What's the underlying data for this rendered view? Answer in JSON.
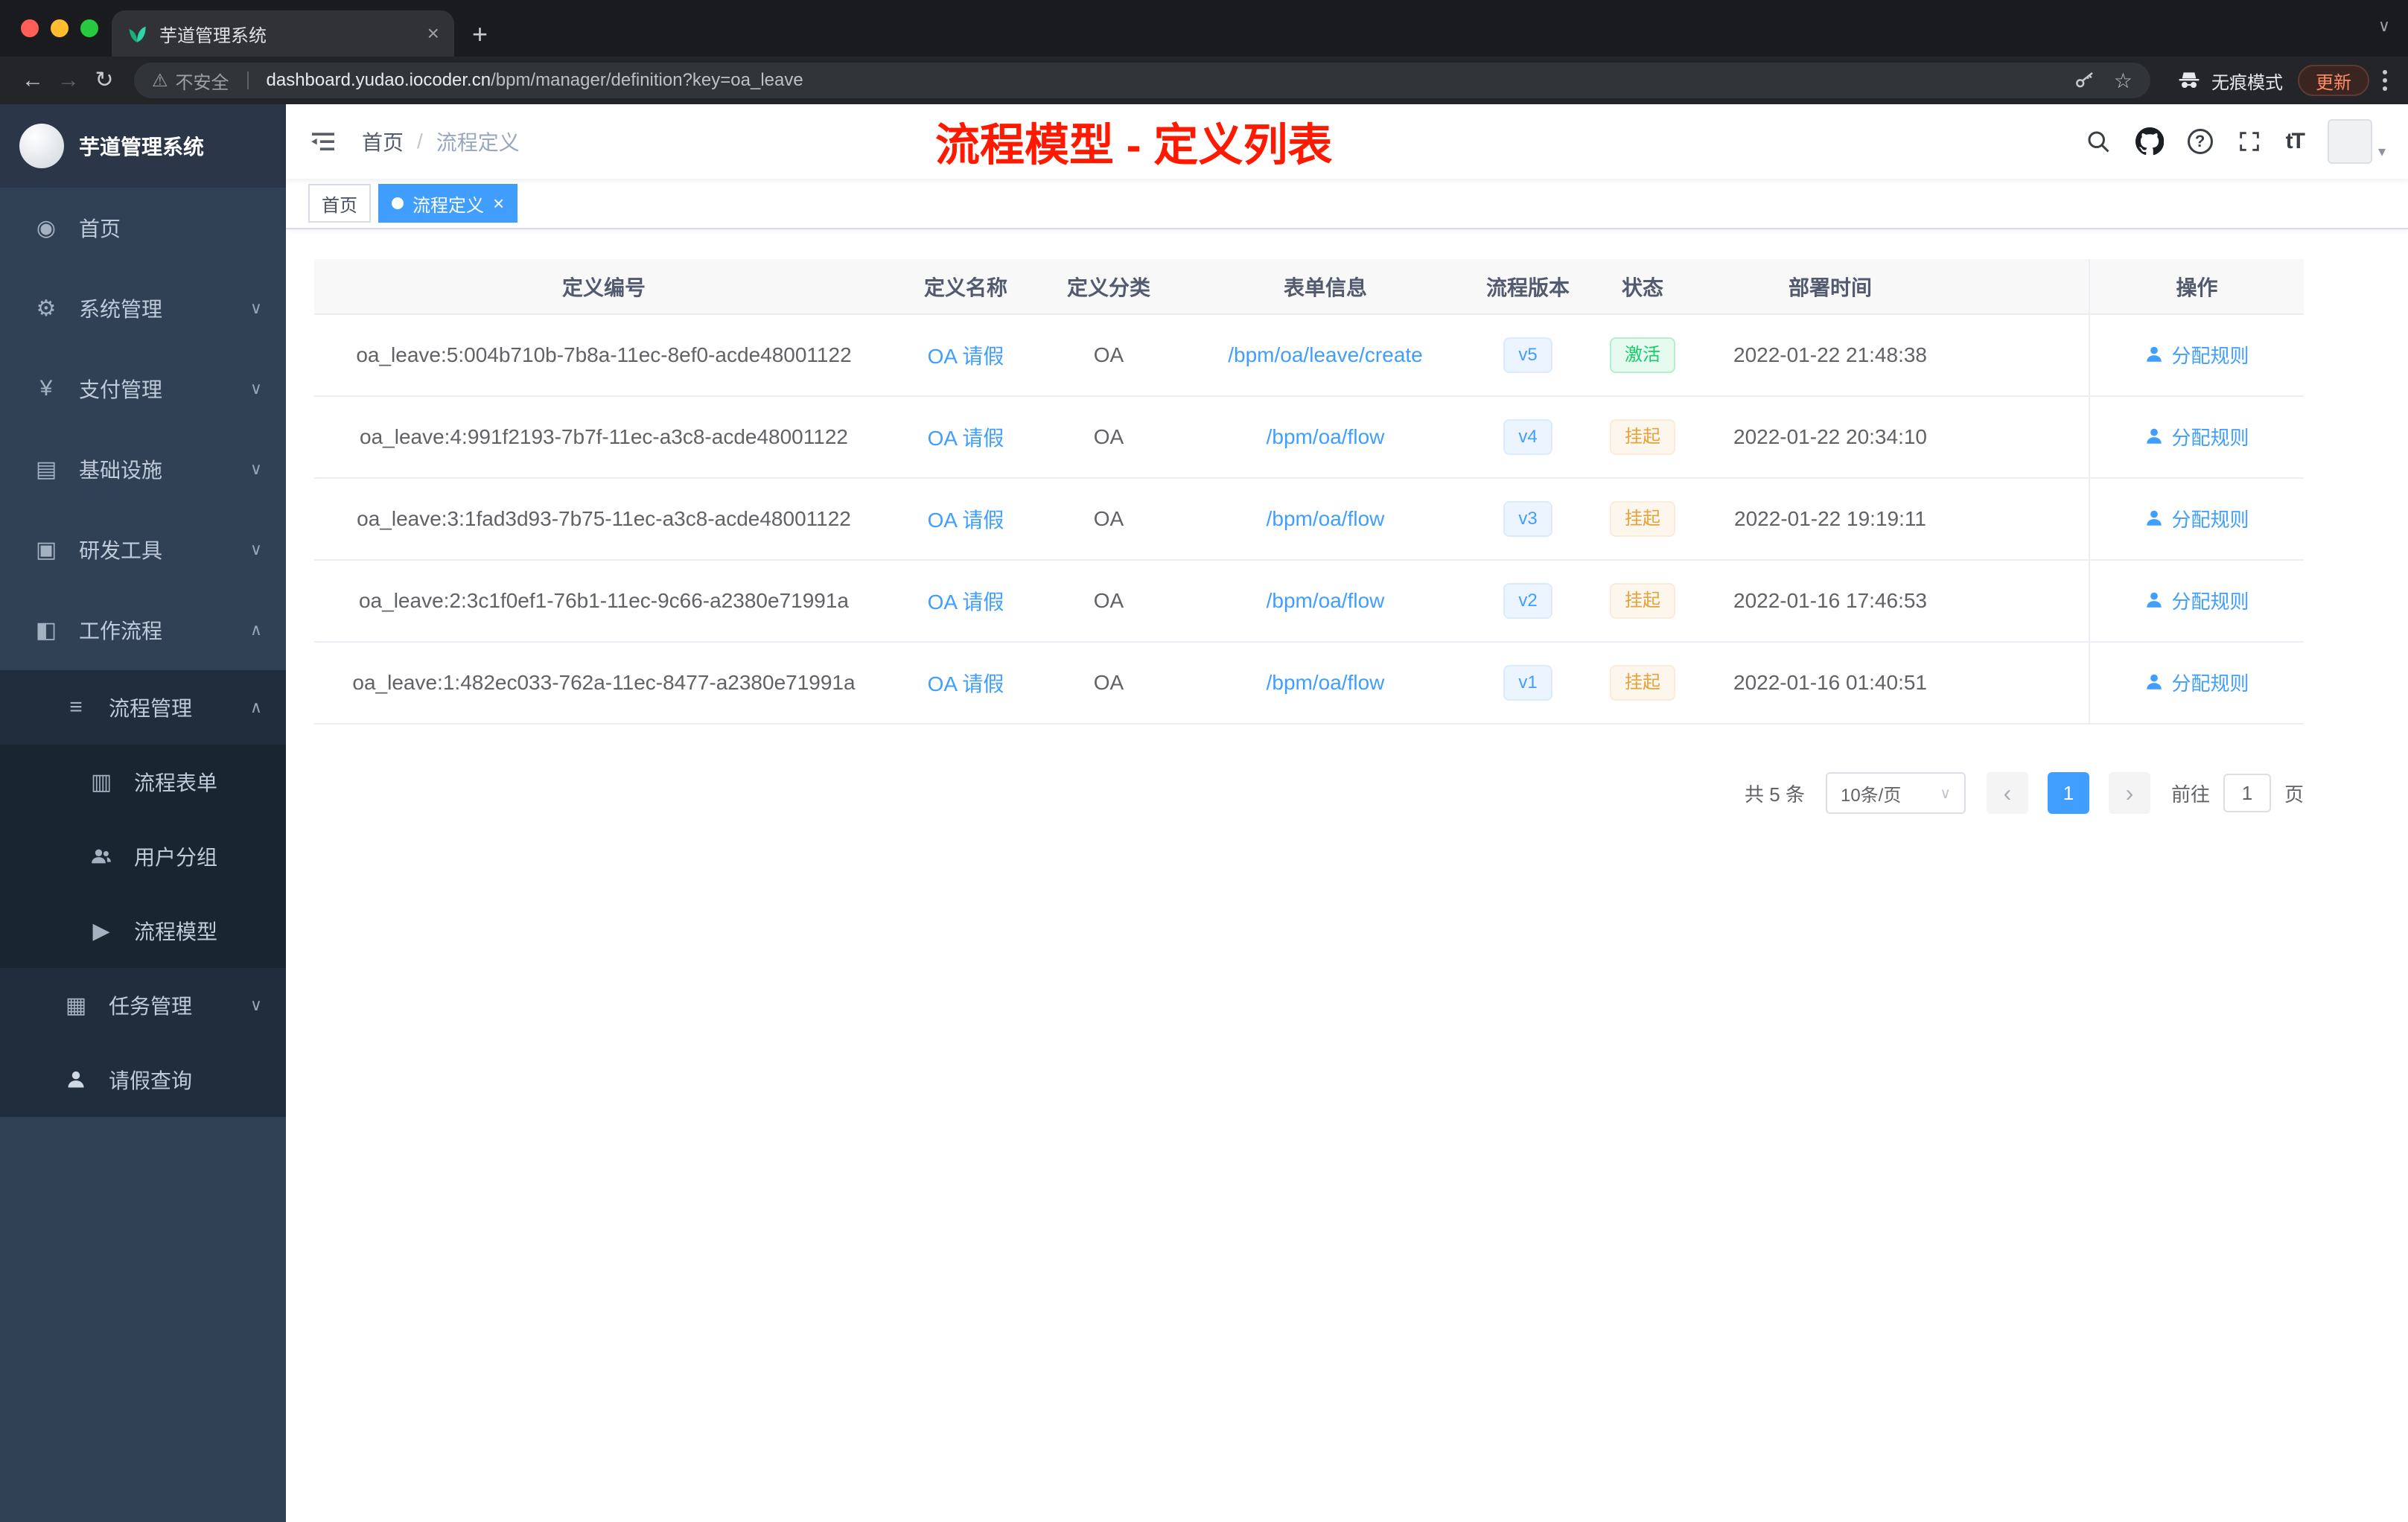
{
  "colors": {
    "accent": "#409eff",
    "sidebar_bg": "#304156",
    "sidebar_sub_bg": "#1f2d3d",
    "sidebar_sub2_bg": "#182631",
    "annotation": "#fe1900",
    "success_text": "#13ce66",
    "success_bg": "#e7faf0",
    "warning_text": "#e6a23c",
    "warning_bg": "#fdf6ec",
    "update": "#ff8a65"
  },
  "icons": {
    "close": "×",
    "plus": "+",
    "tab_caret": "∨",
    "back": "←",
    "forward": "→",
    "reload": "↻",
    "warning": "⚠",
    "star": "☆",
    "question": "?",
    "font_size": "tT",
    "avatar_caret": "▾",
    "chevron_down": "∨",
    "chevron_up": "∧",
    "breadcrumb_sep": "/",
    "prev": "‹",
    "next": "›",
    "home": "◉",
    "system": "⚙",
    "payment": "¥",
    "infra": "▤",
    "devtools": "▣",
    "workflow": "◧",
    "process_mgmt": "≡",
    "process_form": "▥",
    "process_model": "▶",
    "task_mgmt": "▦"
  },
  "browser": {
    "tab_title": "芋道管理系统",
    "url_security": "不安全",
    "url_domain": "dashboard.yudao.iocoder.cn",
    "url_path": "/bpm/manager/definition?key=oa_leave",
    "incognito_label": "无痕模式",
    "update_label": "更新"
  },
  "sidebar": {
    "logo_title": "芋道管理系统",
    "items": [
      "首页",
      "系统管理",
      "支付管理",
      "基础设施",
      "研发工具",
      "工作流程",
      "流程管理",
      "流程表单",
      "用户分组",
      "流程模型",
      "任务管理",
      "请假查询"
    ]
  },
  "header": {
    "breadcrumb": [
      "首页",
      "流程定义"
    ],
    "annotation": "流程模型 - 定义列表"
  },
  "tags": [
    {
      "label": "首页",
      "active": false
    },
    {
      "label": "流程定义",
      "active": true
    }
  ],
  "table": {
    "columns": [
      "定义编号",
      "定义名称",
      "定义分类",
      "表单信息",
      "流程版本",
      "状态",
      "部署时间",
      "操作"
    ],
    "rows": [
      {
        "id": "oa_leave:5:004b710b-7b8a-11ec-8ef0-acde48001122",
        "name": "OA 请假",
        "category": "OA",
        "form": "/bpm/oa/leave/create",
        "version": "v5",
        "status": "激活",
        "status_type": "success",
        "deployed_at": "2022-01-22 21:48:38",
        "action": "分配规则"
      },
      {
        "id": "oa_leave:4:991f2193-7b7f-11ec-a3c8-acde48001122",
        "name": "OA 请假",
        "category": "OA",
        "form": "/bpm/oa/flow",
        "version": "v4",
        "status": "挂起",
        "status_type": "warning",
        "deployed_at": "2022-01-22 20:34:10",
        "action": "分配规则"
      },
      {
        "id": "oa_leave:3:1fad3d93-7b75-11ec-a3c8-acde48001122",
        "name": "OA 请假",
        "category": "OA",
        "form": "/bpm/oa/flow",
        "version": "v3",
        "status": "挂起",
        "status_type": "warning",
        "deployed_at": "2022-01-22 19:19:11",
        "action": "分配规则"
      },
      {
        "id": "oa_leave:2:3c1f0ef1-76b1-11ec-9c66-a2380e71991a",
        "name": "OA 请假",
        "category": "OA",
        "form": "/bpm/oa/flow",
        "version": "v2",
        "status": "挂起",
        "status_type": "warning",
        "deployed_at": "2022-01-16 17:46:53",
        "action": "分配规则"
      },
      {
        "id": "oa_leave:1:482ec033-762a-11ec-8477-a2380e71991a",
        "name": "OA 请假",
        "category": "OA",
        "form": "/bpm/oa/flow",
        "version": "v1",
        "status": "挂起",
        "status_type": "warning",
        "deployed_at": "2022-01-16 01:40:51",
        "action": "分配规则"
      }
    ]
  },
  "pagination": {
    "total_text": "共 5 条",
    "page_size": "10条/页",
    "current_page": "1",
    "goto_label": "前往",
    "goto_value": "1",
    "page_unit": "页"
  }
}
